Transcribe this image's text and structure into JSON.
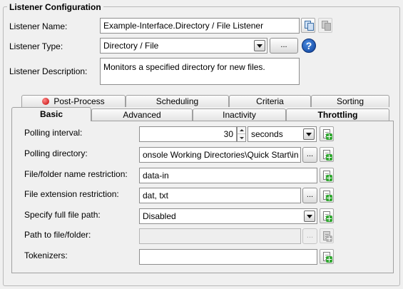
{
  "group": {
    "title": "Listener Configuration"
  },
  "listener": {
    "name_label": "Listener Name:",
    "name_value": "Example-Interface.Directory / File Listener",
    "type_label": "Listener Type:",
    "type_value": "Directory / File",
    "type_browse": "...",
    "help_glyph": "?",
    "desc_label": "Listener Description:",
    "desc_value": "Monitors a specified directory for new files."
  },
  "tabs": {
    "row1": [
      {
        "label": "Post-Process",
        "icon": "error-dot-icon"
      },
      {
        "label": "Scheduling"
      },
      {
        "label": "Criteria"
      },
      {
        "label": "Sorting"
      }
    ],
    "row2": [
      {
        "label": "Basic",
        "active": true
      },
      {
        "label": "Advanced"
      },
      {
        "label": "Inactivity"
      },
      {
        "label": "Throttling"
      }
    ]
  },
  "basic": {
    "polling_interval_label": "Polling interval:",
    "polling_interval_value": "30",
    "polling_unit": "seconds",
    "polling_directory_label": "Polling directory:",
    "polling_directory_value": "onsole Working Directories\\Quick Start\\in",
    "name_restriction_label": "File/folder name restriction:",
    "name_restriction_value": "data-in",
    "ext_restriction_label": "File extension restriction:",
    "ext_restriction_value": "dat, txt",
    "full_path_label": "Specify full file path:",
    "full_path_value": "Disabled",
    "path_label": "Path to file/folder:",
    "path_value": "",
    "tokenizers_label": "Tokenizers:",
    "tokenizers_value": "",
    "browse": "..."
  },
  "icons": {
    "add": "add-token-icon",
    "copy": "copy-icon",
    "help": "help-icon"
  },
  "colors": {
    "background": "#f0f0f0",
    "help_blue": "#0b3f9a",
    "add_green": "#32a832",
    "error_red": "#c10000"
  }
}
